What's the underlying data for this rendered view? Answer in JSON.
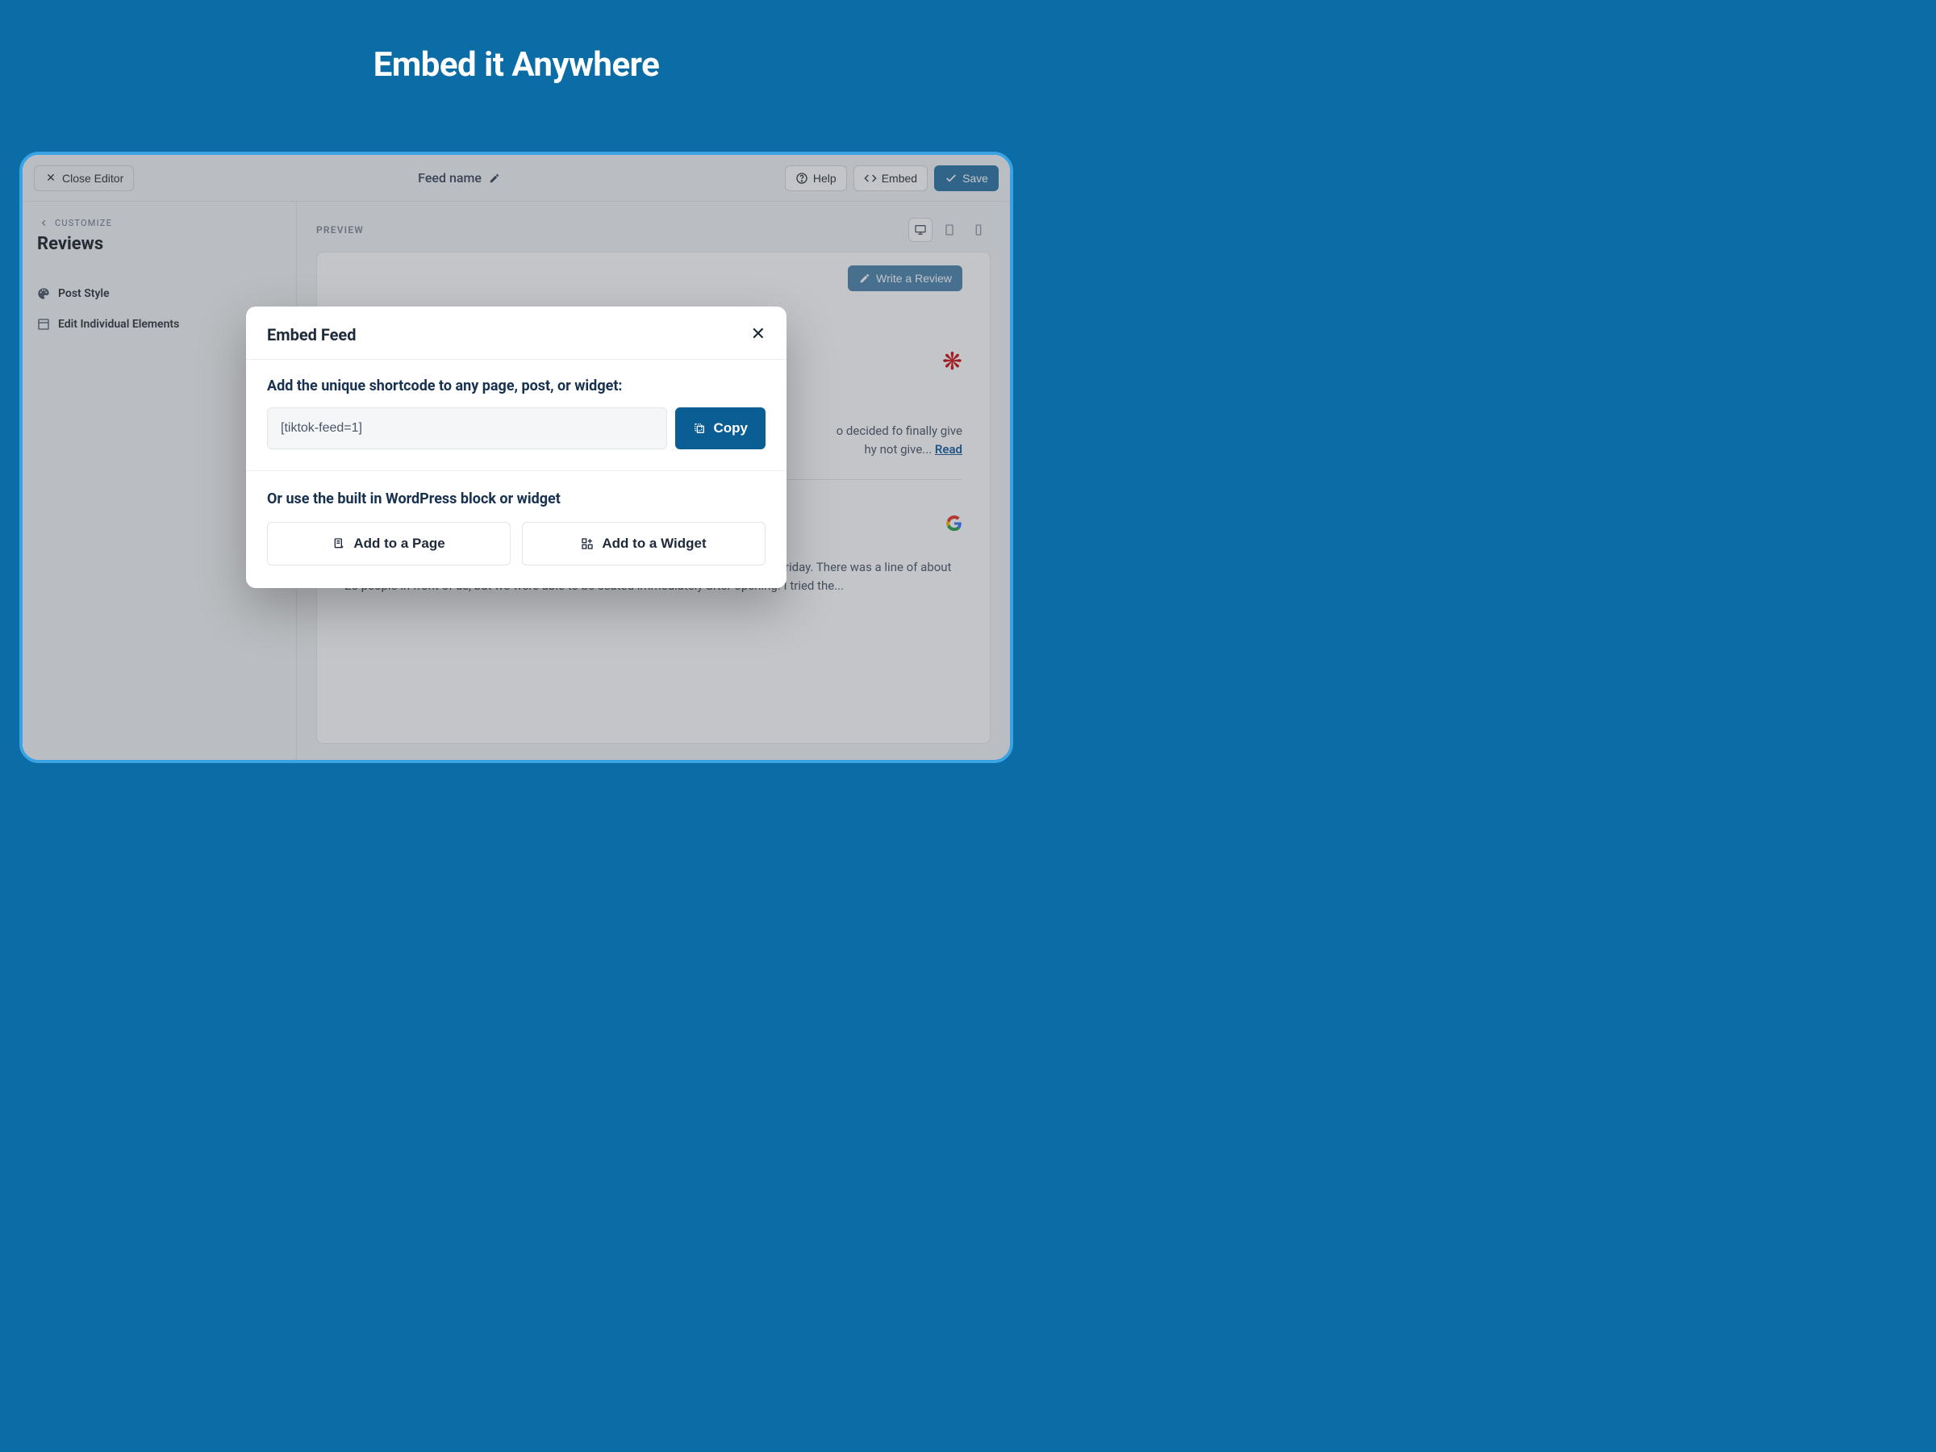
{
  "hero": {
    "title": "Embed it Anywhere"
  },
  "topbar": {
    "close": "Close Editor",
    "feed_name": "Feed name",
    "help": "Help",
    "embed": "Embed",
    "save": "Save"
  },
  "sidebar": {
    "crumb": "CUSTOMIZE",
    "title": "Reviews",
    "items": [
      {
        "label": "Post Style"
      },
      {
        "label": "Edit Individual Elements"
      }
    ]
  },
  "content": {
    "preview_label": "PREVIEW",
    "write_review": "Write a Review"
  },
  "reviews": [
    {
      "source": "yelp",
      "text_frag": "o decided fo finally give",
      "text_frag2": "hy not give...",
      "read_more": "Read"
    },
    {
      "source": "google",
      "text": "Marufuku was amazing! We arrived around 10:40am for 11am opening time on a Friday. There was a line of about 25 people in front of us, but we were able to be seated immediately after opening. I tried the..."
    }
  ],
  "modal": {
    "title": "Embed Feed",
    "sub1": "Add the unique shortcode to any page, post, or widget:",
    "shortcode": "[tiktok-feed=1]",
    "copy": "Copy",
    "sub2": "Or use the built in WordPress block or widget",
    "add_page": "Add to a Page",
    "add_widget": "Add to a Widget"
  }
}
